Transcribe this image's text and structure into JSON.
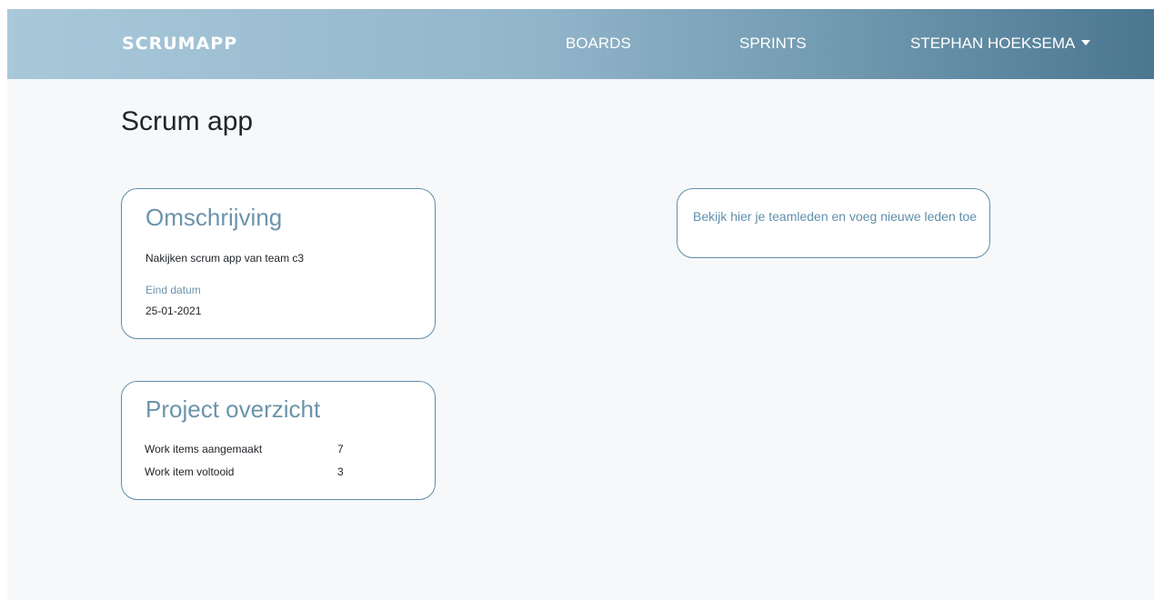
{
  "navbar": {
    "brand": "SCRUMAPP",
    "links": {
      "boards": "BOARDS",
      "sprints": "SPRINTS"
    },
    "user": {
      "name": "STEPHAN HOEKSEMA",
      "dropdown_icon": "caret-down-icon"
    }
  },
  "page": {
    "title": "Scrum app"
  },
  "description_card": {
    "heading": "Omschrijving",
    "description": "Nakijken scrum app van team c3",
    "end_date_label": "Eind datum",
    "end_date": "25-01-2021"
  },
  "overview_card": {
    "heading": "Project overzicht",
    "rows": [
      {
        "label": "Work items aangemaakt",
        "value": "7"
      },
      {
        "label": "Work item voltooid",
        "value": "3"
      }
    ]
  },
  "team_card": {
    "text": "Bekijk hier je teamleden en voeg nieuwe leden toe"
  },
  "colors": {
    "accent": "#6b94ab",
    "card_border": "#5f8fac",
    "page_background": "#f7f8fa",
    "navbar_gradient_start": "#a9c8da",
    "navbar_gradient_end": "#4b7690"
  }
}
